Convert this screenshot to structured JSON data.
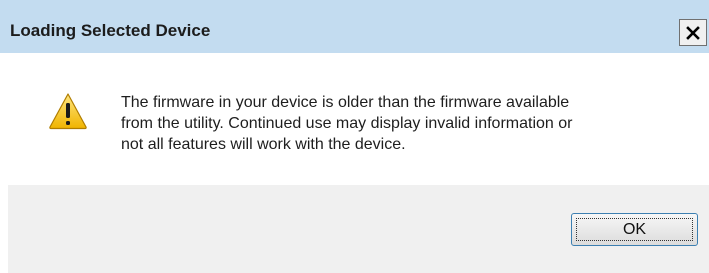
{
  "window": {
    "title": "Loading Selected Device",
    "close_icon": "close-icon"
  },
  "message": {
    "icon": "warning-icon",
    "lines": [
      "The firmware in your device is older than the firmware available",
      "from the utility. Continued use may display invalid information or",
      "not all features will work with the device."
    ]
  },
  "buttons": {
    "ok_label": "OK"
  },
  "colors": {
    "titlebar": "#c3dcf0",
    "warning_fill": "#f5c21a",
    "footer": "#f0f0f0"
  }
}
